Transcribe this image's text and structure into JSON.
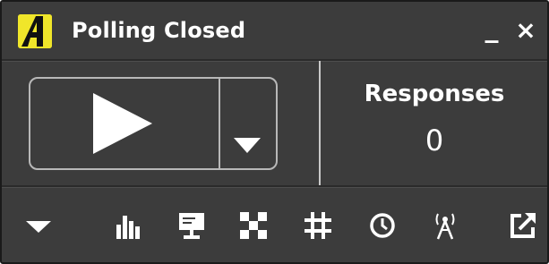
{
  "window": {
    "title": "Polling Closed",
    "logo_icon": "app-logo-icon",
    "minimize_label": "_",
    "close_label": "×"
  },
  "controls": {
    "play_icon": "play-icon",
    "dropdown_icon": "chevron-down-icon"
  },
  "responses": {
    "label": "Responses",
    "count": "0"
  },
  "toolbar": {
    "icons": [
      "menu-dropdown-icon",
      "bar-chart-icon",
      "presentation-icon",
      "checkerboard-icon",
      "crop-frame-icon",
      "clock-icon",
      "broadcast-antenna-icon",
      "external-link-icon"
    ]
  },
  "colors": {
    "background": "#3c3c3c",
    "foreground": "#ffffff",
    "border": "#b8b8b8",
    "logo_yellow": "#f0e62a"
  }
}
